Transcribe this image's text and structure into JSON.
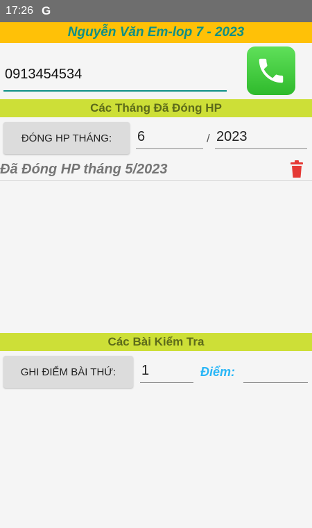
{
  "status_bar": {
    "time": "17:26",
    "google_icon": "G"
  },
  "header": {
    "title": "Nguyễn Văn Em-lop 7 - 2023"
  },
  "phone": {
    "number": "0913454534",
    "call_icon": "phone-icon"
  },
  "fees_section": {
    "title": "Các Tháng Đã Đóng HP",
    "pay_button": "ĐÓNG HP THÁNG:",
    "month_value": "6",
    "separator": "/",
    "year_value": "2023",
    "paid_items": [
      {
        "text": "Đã Đóng HP tháng 5/2023",
        "delete_icon": "trash-icon"
      }
    ]
  },
  "tests_section": {
    "title": "Các Bài Kiểm Tra",
    "grade_button": "GHI ĐIỂM BÀI THỨ:",
    "test_number": "1",
    "score_label": "Điểm:",
    "score_value": ""
  },
  "colors": {
    "title_bg": "#ffc107",
    "title_text": "#0e8f86",
    "section_bg": "#cddf37",
    "section_text": "#5d6b1a",
    "score_label": "#29b6f6",
    "trash": "#e53935",
    "call_button": "#3cc93a"
  }
}
